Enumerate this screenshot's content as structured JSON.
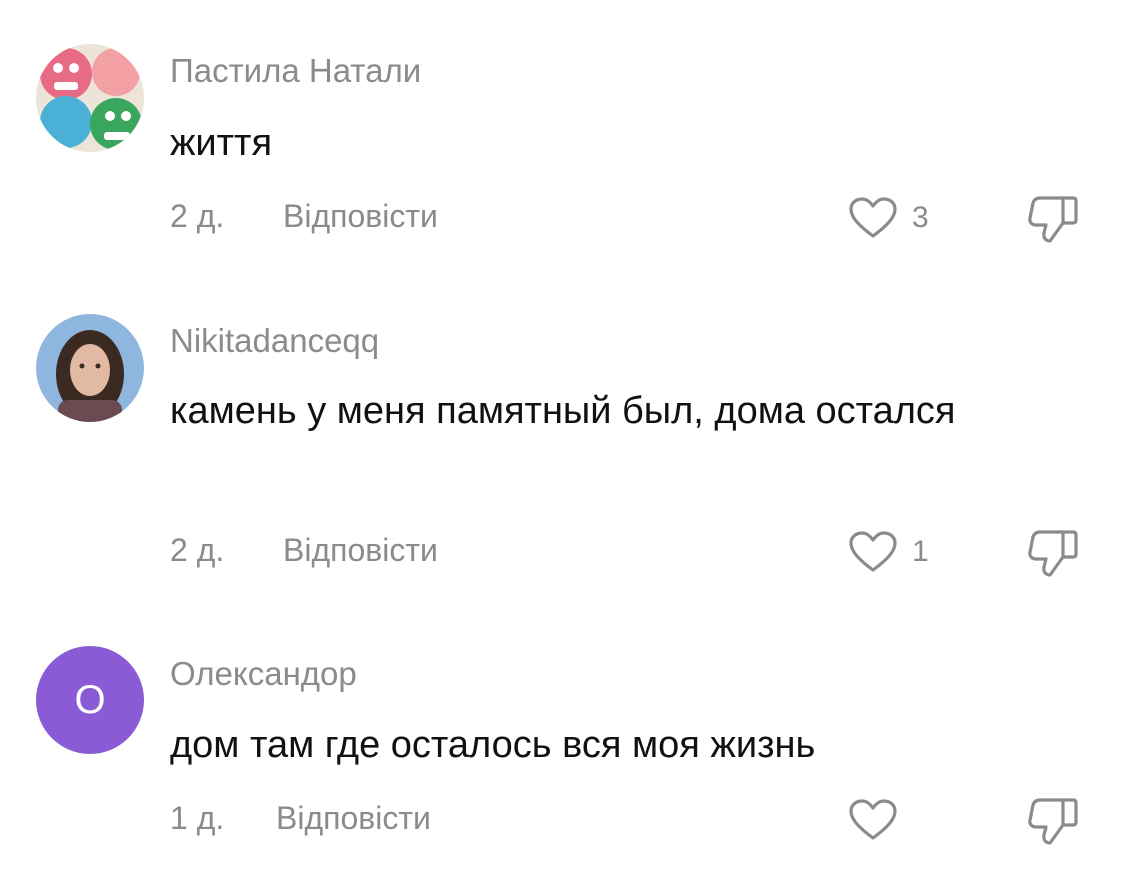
{
  "comments": [
    {
      "username": "Пастила Натали",
      "text": "життя",
      "time": "2 д.",
      "reply_label": "Відповісти",
      "likes": "3"
    },
    {
      "username": "Nikitadanceqq",
      "text": "камень у меня памятный был, дома остался",
      "time": "2 д.",
      "reply_label": "Відповісти",
      "likes": "1"
    },
    {
      "username": "Олександор",
      "avatar_letter": "О",
      "text": "дом там где осталось вся моя жизнь",
      "time": "1 д.",
      "reply_label": "Відповісти",
      "likes": ""
    }
  ],
  "icons": {
    "like": "heart-outline-icon",
    "dislike": "thumbs-down-icon"
  },
  "colors": {
    "muted_text": "#8a8a8f",
    "body_text": "#111111",
    "avatar_purple": "#8b5bd6"
  }
}
